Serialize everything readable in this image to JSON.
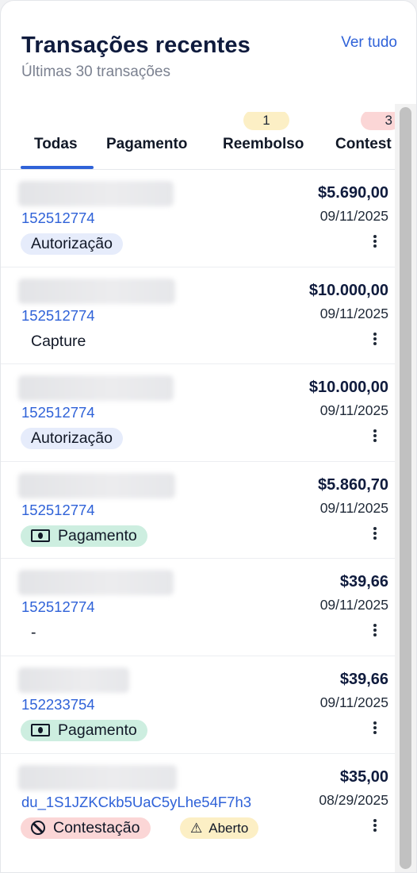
{
  "header": {
    "title": "Transações recentes",
    "subtitle": "Últimas 30 transações",
    "see_all": "Ver tudo"
  },
  "tabs": [
    {
      "label": "Todas",
      "active": true
    },
    {
      "label": "Pagamento"
    },
    {
      "label": "Reembolso",
      "count": "1",
      "count_color": "#fcefc5"
    },
    {
      "label": "Contest",
      "count": "3",
      "count_color": "#fbd6d6"
    }
  ],
  "transactions": [
    {
      "id": "152512774",
      "amount": "$5.690,00",
      "date": "09/11/2025",
      "tag": "Autorização",
      "tag_style": "auth"
    },
    {
      "id": "152512774",
      "amount": "$10.000,00",
      "date": "09/11/2025",
      "tag": "Capture",
      "tag_style": "plain"
    },
    {
      "id": "152512774",
      "amount": "$10.000,00",
      "date": "09/11/2025",
      "tag": "Autorização",
      "tag_style": "auth"
    },
    {
      "id": "152512774",
      "amount": "$5.860,70",
      "date": "09/11/2025",
      "tag": "Pagamento",
      "tag_style": "pay",
      "tag_icon": "cash-icon"
    },
    {
      "id": "152512774",
      "amount": "$39,66",
      "date": "09/11/2025",
      "tag": "-",
      "tag_style": "plain"
    },
    {
      "id": "152233754",
      "amount": "$39,66",
      "date": "09/11/2025",
      "tag": "Pagamento",
      "tag_style": "pay",
      "tag_icon": "cash-icon"
    },
    {
      "id": "du_1S1JZKCkb5UaC5yLhe54F7h3",
      "amount": "$35,00",
      "date": "08/29/2025",
      "tag": "Contestação",
      "tag_style": "dispute",
      "tag_icon": "ban-icon",
      "status": "Aberto",
      "status_icon": "warning-icon"
    }
  ],
  "colors": {
    "accent": "#2f62d8",
    "title": "#0f1b3d",
    "auth_tag": "#e6ecfb",
    "pay_tag": "#cdeee0",
    "dispute_tag": "#fbd6d6",
    "open_tag": "#fcefc5"
  }
}
